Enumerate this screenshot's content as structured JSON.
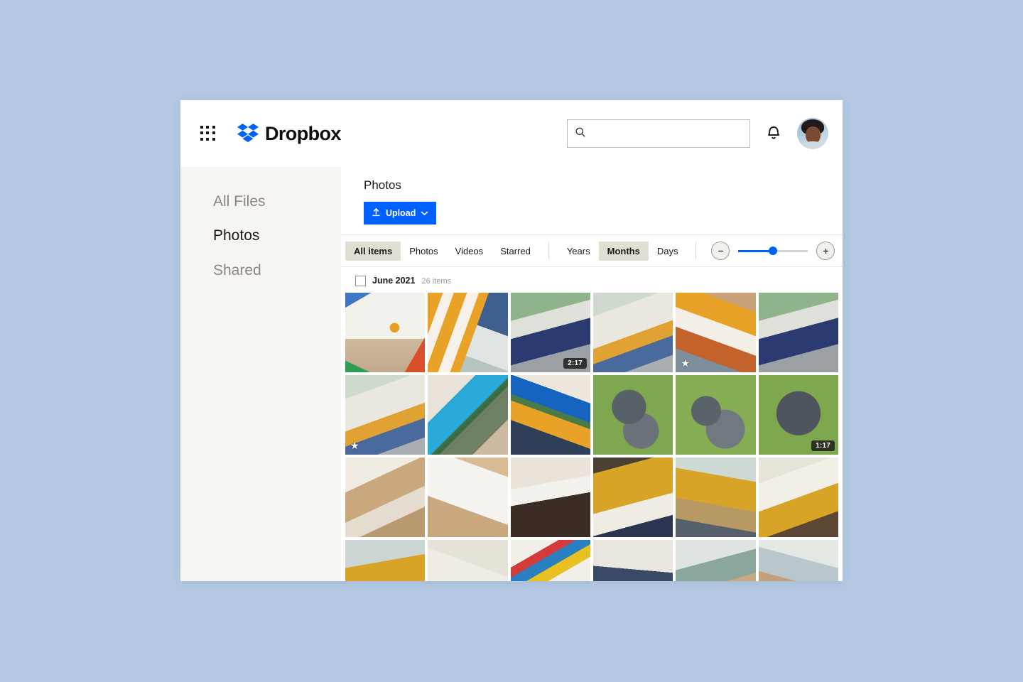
{
  "app": {
    "brand_name": "Dropbox",
    "grid_menu_icon": "app-grid-icon",
    "logo_icon": "dropbox-logo-icon"
  },
  "search": {
    "value": "",
    "placeholder": "",
    "icon": "search-icon"
  },
  "header": {
    "notifications_icon": "bell-icon",
    "avatar_label": "account-avatar"
  },
  "sidebar": {
    "items": [
      {
        "label": "All Files",
        "active": false
      },
      {
        "label": "Photos",
        "active": true
      },
      {
        "label": "Shared",
        "active": false
      }
    ]
  },
  "page": {
    "title": "Photos",
    "upload_label": "Upload",
    "upload_icon": "upload-arrow-icon",
    "upload_chevron": "chevron-down-icon",
    "accent_color": "#0061fe"
  },
  "toolbar": {
    "filter_tabs": [
      {
        "label": "All items",
        "active": true
      },
      {
        "label": "Photos",
        "active": false
      },
      {
        "label": "Videos",
        "active": false
      },
      {
        "label": "Starred",
        "active": false
      }
    ],
    "range_tabs": [
      {
        "label": "Years",
        "active": false
      },
      {
        "label": "Months",
        "active": true
      },
      {
        "label": "Days",
        "active": false
      }
    ],
    "zoom_out_icon": "zoom-out-circle-icon",
    "zoom_in_icon": "zoom-in-circle-icon",
    "zoom_level_percent": 50,
    "active_tab_color": "#e3ded4"
  },
  "section": {
    "checkbox_checked": false,
    "title": "June 2021",
    "count_label": "26 items"
  },
  "grid": {
    "columns": 6,
    "items": [
      {
        "name": "photo-childrens-artwork-on-sand",
        "style": "p-art",
        "badge": null,
        "starred": false
      },
      {
        "name": "photo-child-striped-sweater-on-bench",
        "style": "p-bench",
        "badge": null,
        "starred": false
      },
      {
        "name": "video-two-people-on-porch-swing",
        "style": "p-swing",
        "badge": "2:17",
        "starred": false
      },
      {
        "name": "photo-child-sitting-on-bench",
        "style": "p-porch",
        "badge": null,
        "starred": false
      },
      {
        "name": "photo-child-smiling-reaching-out",
        "style": "p-smile",
        "badge": null,
        "starred": true
      },
      {
        "name": "photo-mother-and-child-on-swing",
        "style": "p-swing",
        "badge": null,
        "starred": false
      },
      {
        "name": "photo-family-on-porch-swing",
        "style": "p-porch",
        "badge": null,
        "starred": true
      },
      {
        "name": "photo-woman-painting-mural",
        "style": "p-mural1",
        "badge": null,
        "starred": false
      },
      {
        "name": "photo-mother-and-child-painting-wall",
        "style": "p-mural2",
        "badge": null,
        "starred": false
      },
      {
        "name": "photo-two-cattle-dogs-on-grass",
        "style": "p-dog1",
        "badge": null,
        "starred": false
      },
      {
        "name": "photo-two-dogs-looking-up",
        "style": "p-dog2",
        "badge": null,
        "starred": false
      },
      {
        "name": "video-dog-portrait-closeup",
        "style": "p-dog3",
        "badge": "1:17",
        "starred": false
      },
      {
        "name": "photo-child-painting-with-watercolors",
        "style": "p-paint1",
        "badge": null,
        "starred": false
      },
      {
        "name": "photo-finished-watercolor-painting",
        "style": "p-paint2",
        "badge": null,
        "starred": false
      },
      {
        "name": "photo-child-braids-above-painting",
        "style": "p-paint3",
        "badge": null,
        "starred": false
      },
      {
        "name": "photo-father-hugging-child",
        "style": "p-dad1",
        "badge": null,
        "starred": false
      },
      {
        "name": "photo-father-lifting-child-by-window",
        "style": "p-dad2",
        "badge": null,
        "starred": false
      },
      {
        "name": "photo-father-and-laughing-child",
        "style": "p-dad3",
        "badge": null,
        "starred": false
      },
      {
        "name": "photo-father-and-daughter-smiling",
        "style": "p-fam1",
        "badge": null,
        "starred": false
      },
      {
        "name": "photo-child-leaning-close-to-camera",
        "style": "p-fam2",
        "badge": null,
        "starred": false
      },
      {
        "name": "photo-hand-painting-with-palette",
        "style": "p-fam3",
        "badge": null,
        "starred": false
      },
      {
        "name": "photo-child-sitting-on-floor-drawing",
        "style": "p-fam4",
        "badge": null,
        "starred": false
      },
      {
        "name": "photo-family-playing-indoors",
        "style": "p-fam5",
        "badge": null,
        "starred": false
      },
      {
        "name": "photo-parents-holding-toddler",
        "style": "p-fam6",
        "badge": null,
        "starred": false
      }
    ]
  }
}
